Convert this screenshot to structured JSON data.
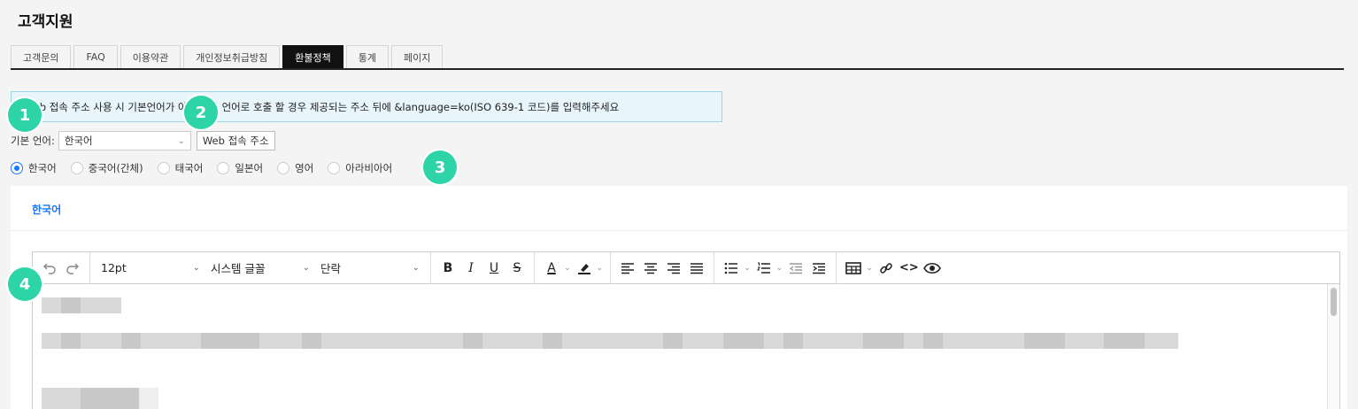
{
  "page_title": "고객지원",
  "tabs": [
    {
      "label": "고객문의",
      "active": false
    },
    {
      "label": "FAQ",
      "active": false
    },
    {
      "label": "이용약관",
      "active": false
    },
    {
      "label": "개인정보취급방침",
      "active": false
    },
    {
      "label": "환불정책",
      "active": true
    },
    {
      "label": "통계",
      "active": false
    },
    {
      "label": "페이지",
      "active": false
    }
  ],
  "notice": {
    "text": "Web 접속 주소 사용 시 기본언어가 아닌 다른 언어로 호출 할 경우 제공되는 주소 뒤에 &language=ko(ISO 639-1 코드)를 입력해주세요"
  },
  "language": {
    "label": "기본 언어:",
    "selected": "한국어",
    "web_button": "Web 접속 주소"
  },
  "radios": [
    {
      "label": "한국어",
      "checked": true
    },
    {
      "label": "중국어(간체)",
      "checked": false
    },
    {
      "label": "태국어",
      "checked": false
    },
    {
      "label": "일본어",
      "checked": false
    },
    {
      "label": "영어",
      "checked": false
    },
    {
      "label": "아라비아어",
      "checked": false
    }
  ],
  "badges": [
    "1",
    "2",
    "3",
    "4"
  ],
  "panel": {
    "active_tab": "한국어"
  },
  "toolbar": {
    "font_size": "12pt",
    "font_family": "시스템 글꼴",
    "block_format": "단락",
    "icons": [
      "undo-icon",
      "redo-icon",
      "bold-icon",
      "italic-icon",
      "underline-icon",
      "strikethrough-icon",
      "text-color-icon",
      "highlight-icon",
      "align-left-icon",
      "align-center-icon",
      "align-right-icon",
      "justify-icon",
      "bullet-list-icon",
      "numbered-list-icon",
      "outdent-icon",
      "indent-icon",
      "table-icon",
      "link-icon",
      "code-icon",
      "preview-icon"
    ]
  },
  "colors": {
    "accent": "#1677ff",
    "badge": "#2dd4a8",
    "active_tab_bg": "#111111",
    "notice_bg": "#e8f6fc"
  }
}
